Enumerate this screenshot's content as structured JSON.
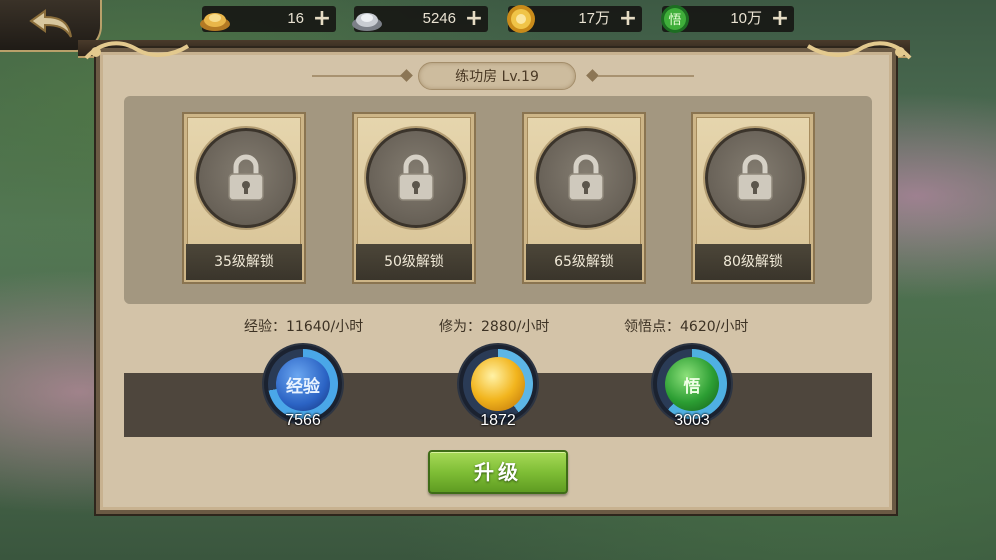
{
  "back_button": {
    "icon": "back-arrow-icon"
  },
  "resources": [
    {
      "id": "gold-ingot",
      "icon": "gold-ingot-icon",
      "value": "16"
    },
    {
      "id": "silver-ingot",
      "icon": "silver-ingot-icon",
      "value": "5246"
    },
    {
      "id": "coin",
      "icon": "gold-coin-icon",
      "value": "17万"
    },
    {
      "id": "insight",
      "icon": "insight-orb-icon",
      "icon_text": "悟",
      "value": "10万"
    }
  ],
  "panel": {
    "title": "练功房 Lv.19",
    "slots": [
      {
        "label": "35级解锁",
        "icon": "lock-icon"
      },
      {
        "label": "50级解锁",
        "icon": "lock-icon"
      },
      {
        "label": "65级解锁",
        "icon": "lock-icon"
      },
      {
        "label": "80级解锁",
        "icon": "lock-icon"
      }
    ],
    "rates": [
      {
        "text": "经验：11640/小时"
      },
      {
        "text": "修为：2880/小时"
      },
      {
        "text": "领悟点：4620/小时"
      }
    ],
    "orbs": [
      {
        "id": "exp",
        "icon_text": "经验",
        "value": "7566",
        "ring_color": "#4aa7e8",
        "core_color": "#2b63c4"
      },
      {
        "id": "cultivation",
        "icon_text": "",
        "value": "1872",
        "ring_color": "#5db6e6",
        "core_color": "#e8a412"
      },
      {
        "id": "insight",
        "icon_text": "悟",
        "value": "3003",
        "ring_color": "#4fb0e2",
        "core_color": "#2c9e33"
      }
    ],
    "upgrade_label": "升级"
  }
}
